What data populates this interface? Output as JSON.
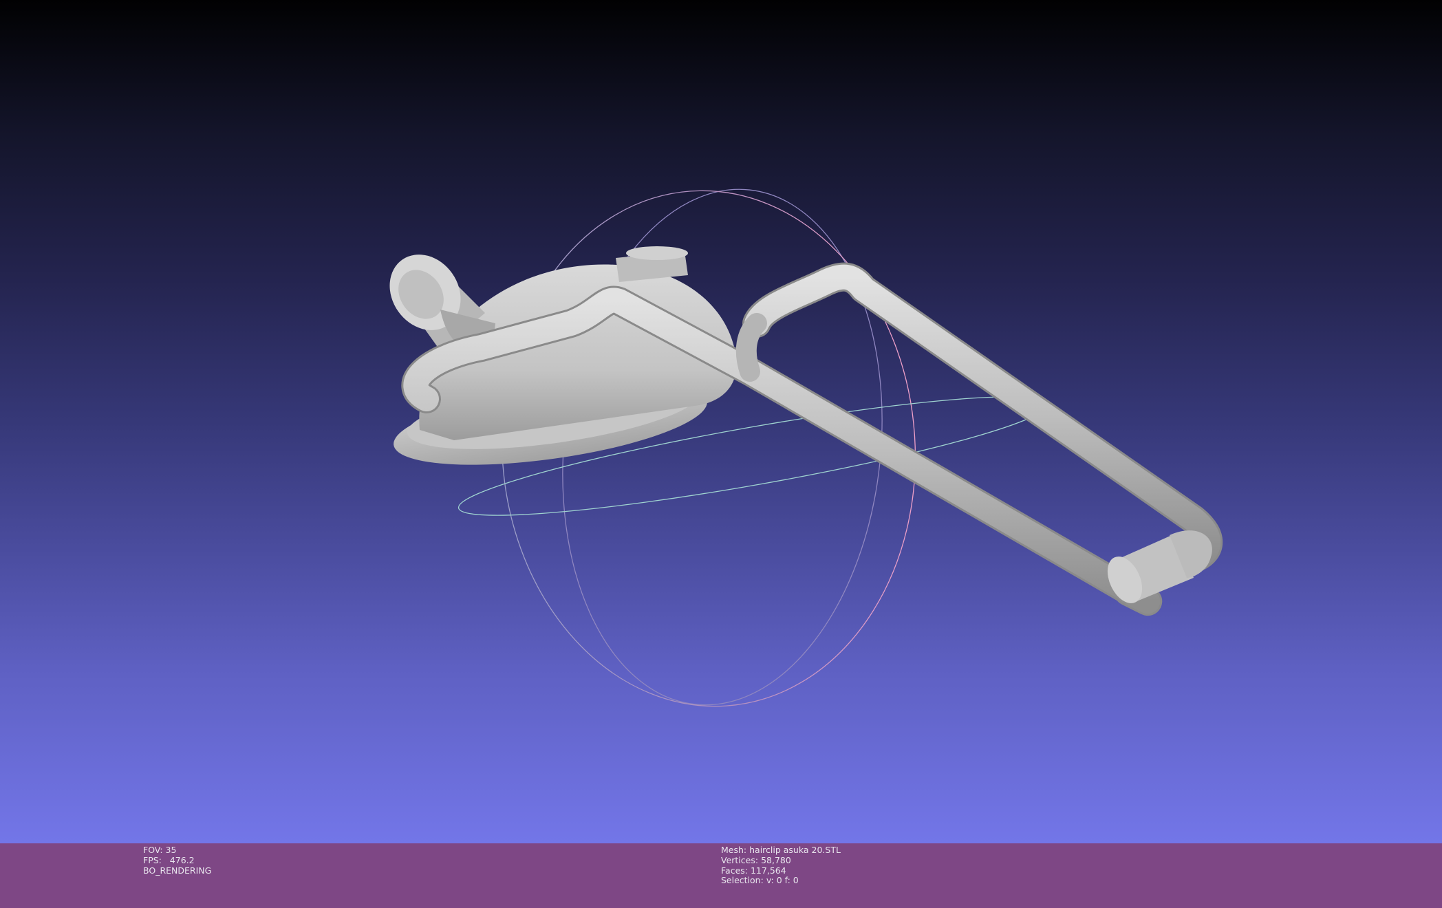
{
  "viewport": {
    "background_top": "#010102",
    "background_bottom": "#7376e8",
    "mesh_color": "#c8c8c8"
  },
  "info_left": {
    "fov_label": "FOV:",
    "fov_value": "35",
    "fps_label": "FPS:",
    "fps_value": "476.2",
    "render_mode": "BO_RENDERING"
  },
  "info_right": {
    "mesh_label": "Mesh:",
    "mesh_name": "hairclip asuka 20.STL",
    "vertices_label": "Vertices:",
    "vertices_value": "58,780",
    "faces_label": "Faces:",
    "faces_value": "117,564",
    "selection_label": "Selection:",
    "selection_value": "v: 0 f: 0"
  },
  "infobar_color": "#7e4785"
}
